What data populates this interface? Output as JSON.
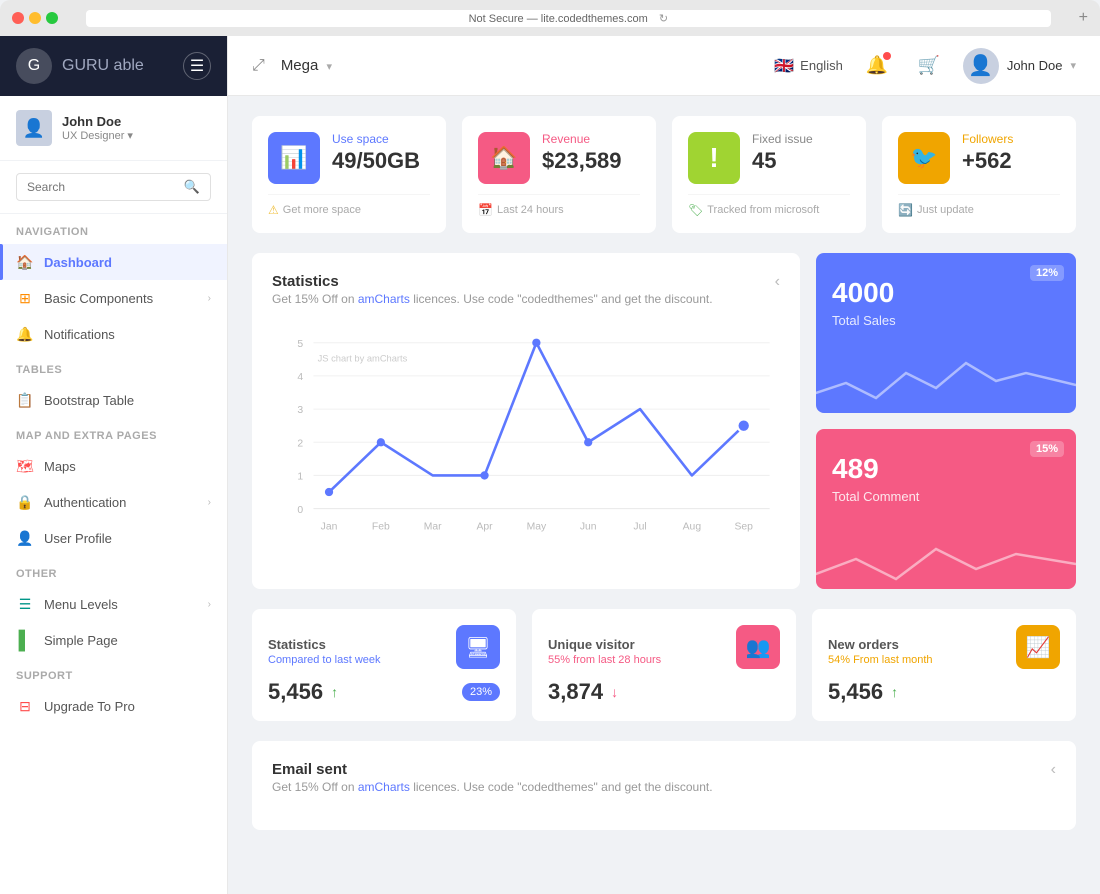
{
  "browser": {
    "url": "Not Secure — lite.codedthemes.com",
    "refresh_icon": "↻",
    "add_tab": "+"
  },
  "brand": {
    "logo_letter": "G",
    "name": "GURU",
    "name_suffix": " able",
    "menu_icon": "☰"
  },
  "user": {
    "name": "John Doe",
    "role": "UX Designer",
    "role_arrow": "▾",
    "avatar_emoji": "👤"
  },
  "search": {
    "placeholder": "Search",
    "icon": "🔍"
  },
  "nav": {
    "section_navigation": "Navigation",
    "section_tables": "Tables",
    "section_map": "Map And Extra Pages",
    "section_other": "Other",
    "section_support": "Support",
    "items_navigation": [
      {
        "label": "Dashboard",
        "icon": "🏠",
        "icon_class": "red",
        "active": true,
        "has_arrow": false
      },
      {
        "label": "Basic Components",
        "icon": "⊞",
        "icon_class": "orange",
        "active": false,
        "has_arrow": true
      },
      {
        "label": "Notifications",
        "icon": "🔔",
        "icon_class": "pink",
        "active": false,
        "has_arrow": false
      }
    ],
    "items_tables": [
      {
        "label": "Bootstrap Table",
        "icon": "📋",
        "icon_class": "blue",
        "active": false,
        "has_arrow": false
      }
    ],
    "items_map": [
      {
        "label": "Maps",
        "icon": "🗺",
        "icon_class": "red",
        "active": false,
        "has_arrow": false
      },
      {
        "label": "Authentication",
        "icon": "🔒",
        "icon_class": "green",
        "active": false,
        "has_arrow": true
      },
      {
        "label": "User Profile",
        "icon": "👤",
        "icon_class": "purple",
        "active": false,
        "has_arrow": false
      }
    ],
    "items_other": [
      {
        "label": "Menu Levels",
        "icon": "☰",
        "icon_class": "teal",
        "active": false,
        "has_arrow": true
      },
      {
        "label": "Simple Page",
        "icon": "▌",
        "icon_class": "green",
        "active": false,
        "has_arrow": false
      }
    ],
    "items_support": [
      {
        "label": "Upgrade To Pro",
        "icon": "⊟",
        "icon_class": "red",
        "active": false,
        "has_arrow": false
      }
    ]
  },
  "header": {
    "expand_icon": "⤢",
    "title": "Mega",
    "title_arrow": "▾",
    "language": "English",
    "flag": "🇬🇧",
    "user_name": "John Doe",
    "user_arrow": "▾"
  },
  "stat_cards": [
    {
      "label": "Use space",
      "label_class": "blue",
      "value": "49/50GB",
      "icon": "📊",
      "icon_class": "blue",
      "footer_icon": "⚠",
      "footer_icon_class": "yellow",
      "footer_text": "Get more space"
    },
    {
      "label": "Revenue",
      "label_class": "red",
      "value": "$23,589",
      "icon": "🏠",
      "icon_class": "pink",
      "footer_icon": "📅",
      "footer_icon_class": "pink",
      "footer_text": "Last 24 hours"
    },
    {
      "label": "Fixed issue",
      "label_class": "",
      "value": "45",
      "icon": "!",
      "icon_class": "green",
      "footer_icon": "🏷",
      "footer_icon_class": "green",
      "footer_text": "Tracked from microsoft"
    },
    {
      "label": "Followers",
      "label_class": "orange",
      "value": "+562",
      "icon": "🐦",
      "icon_class": "orange",
      "footer_icon": "🔄",
      "footer_icon_class": "orange",
      "footer_text": "Just update"
    }
  ],
  "chart": {
    "title": "Statistics",
    "subtitle": "Get 15% Off on",
    "subtitle_link": "amCharts",
    "subtitle_rest": " licences. Use code \"codedthemes\" and get the discount.",
    "toggle_icon": "‹",
    "js_label": "JS chart by amCharts",
    "x_labels": [
      "Jan",
      "Feb",
      "Mar",
      "Apr",
      "May",
      "Jun",
      "Jul",
      "Aug",
      "Sep"
    ],
    "y_labels": [
      "0",
      "1",
      "2",
      "3",
      "4",
      "5"
    ]
  },
  "kpi_cards": [
    {
      "value": "4000",
      "label": "Total Sales",
      "badge": "12%",
      "class": "blue"
    },
    {
      "value": "489",
      "label": "Total Comment",
      "badge": "15%",
      "class": "pink"
    }
  ],
  "mini_stats": [
    {
      "title": "Statistics",
      "sub": "Compared to last week",
      "sub_class": "blue",
      "value": "5,456",
      "arrow": "↑",
      "arrow_class": "",
      "badge": "23%",
      "icon": "🖥",
      "icon_class": "blue"
    },
    {
      "title": "Unique visitor",
      "sub": "55% from last 28 hours",
      "sub_class": "red",
      "value": "3,874",
      "arrow": "↓",
      "arrow_class": "down",
      "badge": null,
      "icon": "👥",
      "icon_class": "red"
    },
    {
      "title": "New orders",
      "sub": "54% From last month",
      "sub_class": "orange",
      "value": "5,456",
      "arrow": "↑",
      "arrow_class": "",
      "badge": null,
      "icon": "📈",
      "icon_class": "orange"
    }
  ],
  "email_card": {
    "title": "Email sent",
    "subtitle": "Get 15% Off on",
    "subtitle_link": "amCharts",
    "subtitle_rest": " licences. Use code \"codedthemes\" and get the discount.",
    "toggle_icon": "‹"
  }
}
